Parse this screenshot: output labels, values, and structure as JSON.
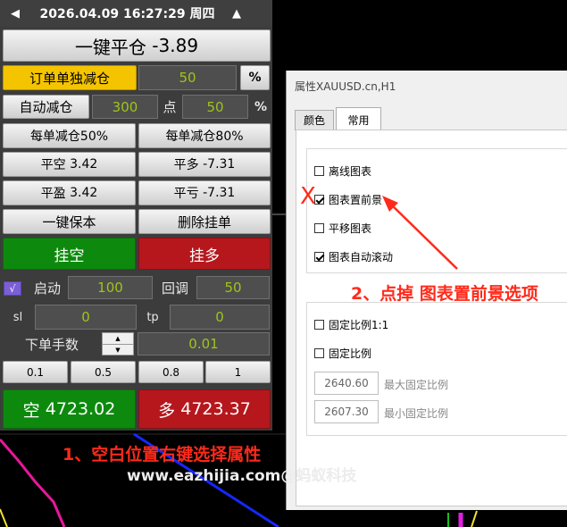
{
  "topbar": {
    "datetime": "2026.04.09 16:27:29 周四",
    "arrow_left": "◀",
    "arrow_right": "▲"
  },
  "close_all": {
    "label": "一键平仓",
    "value": "-3.89"
  },
  "reduce_row": {
    "label": "订单单独减仓",
    "value": "50",
    "unit": "%"
  },
  "auto_reduce": {
    "label": "自动减仓",
    "points": "300",
    "points_unit": "点",
    "percent": "50",
    "percent_unit": "%"
  },
  "reduce_50": "每单减仓50%",
  "reduce_80": "每单减仓80%",
  "close_short": {
    "label": "平空",
    "value": "3.42"
  },
  "close_long": {
    "label": "平多",
    "value": "-7.31"
  },
  "close_profit": {
    "label": "平盈",
    "value": "3.42"
  },
  "close_loss": {
    "label": "平亏",
    "value": "-7.31"
  },
  "breakeven": "一键保本",
  "delete_pending": "删除挂单",
  "pending_short": "挂空",
  "pending_long": "挂多",
  "trailing": {
    "check": "√",
    "start_label": "启动",
    "start_value": "100",
    "pullback_label": "回调",
    "pullback_value": "50"
  },
  "sl": {
    "label": "sl",
    "value": "0"
  },
  "tp": {
    "label": "tp",
    "value": "0"
  },
  "lots": {
    "label": "下单手数",
    "value": "0.01",
    "up": "▲",
    "down": "▼"
  },
  "lot_presets": [
    "0.1",
    "0.5",
    "0.8",
    "1"
  ],
  "sell": {
    "label": "空",
    "price": "4723.02"
  },
  "buy": {
    "label": "多",
    "price": "4723.37"
  },
  "dialog": {
    "title": "属性XAUUSD.cn,H1",
    "tabs": [
      "颜色",
      "常用"
    ],
    "checkboxes": [
      {
        "label": "离线图表",
        "checked": false
      },
      {
        "label": "图表置前景",
        "checked": true
      },
      {
        "label": "平移图表",
        "checked": false
      },
      {
        "label": "图表自动滚动",
        "checked": true
      }
    ],
    "scale_checkboxes": [
      {
        "label": "固定比例1:1",
        "checked": false
      },
      {
        "label": "固定比例",
        "checked": false
      }
    ],
    "max_scale": {
      "value": "2640.60",
      "label": "最大固定比例"
    },
    "min_scale": {
      "value": "2607.30",
      "label": "最小固定比例"
    }
  },
  "annotations": {
    "step1": "1、空白位置右键选择属性",
    "step2": "2、点掉 图表置前景选项",
    "x_mark": "X"
  },
  "watermark": "www.eazhijia.com@蚂蚁科技",
  "colors": {
    "accent_green": "#9ec51a",
    "sell_green": "#0d8a0d",
    "buy_red": "#b5171d",
    "annotation_red": "#ff2a1a",
    "yellow": "#f5c400"
  }
}
